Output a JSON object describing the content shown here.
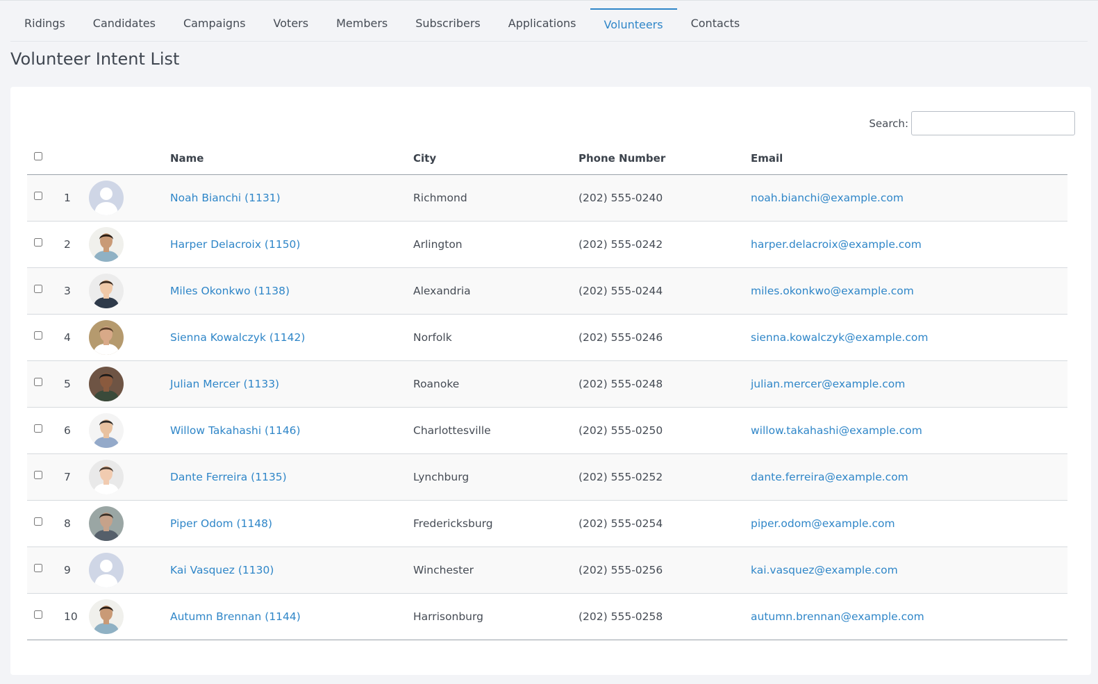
{
  "nav": {
    "tabs": [
      {
        "label": "Ridings"
      },
      {
        "label": "Candidates"
      },
      {
        "label": "Campaigns"
      },
      {
        "label": "Voters"
      },
      {
        "label": "Members"
      },
      {
        "label": "Subscribers"
      },
      {
        "label": "Applications"
      },
      {
        "label": "Volunteers"
      },
      {
        "label": "Contacts"
      }
    ],
    "active": "Volunteers"
  },
  "page": {
    "title": "Volunteer Intent List"
  },
  "search": {
    "label": "Search:",
    "value": "",
    "placeholder": ""
  },
  "table": {
    "headers": {
      "name": "Name",
      "city": "City",
      "phone": "Phone Number",
      "email": "Email"
    },
    "rows": [
      {
        "num": "1",
        "name": "Noah Bianchi (1131)",
        "city": "Richmond",
        "phone": "(202) 555-0240",
        "email": "noah.bianchi@example.com",
        "avatar": "placeholder"
      },
      {
        "num": "2",
        "name": "Harper Delacroix (1150)",
        "city": "Arlington",
        "phone": "(202) 555-0242",
        "email": "harper.delacroix@example.com",
        "avatar": "photo"
      },
      {
        "num": "3",
        "name": "Miles Okonkwo (1138)",
        "city": "Alexandria",
        "phone": "(202) 555-0244",
        "email": "miles.okonkwo@example.com",
        "avatar": "photo"
      },
      {
        "num": "4",
        "name": "Sienna Kowalczyk (1142)",
        "city": "Norfolk",
        "phone": "(202) 555-0246",
        "email": "sienna.kowalczyk@example.com",
        "avatar": "photo"
      },
      {
        "num": "5",
        "name": "Julian Mercer (1133)",
        "city": "Roanoke",
        "phone": "(202) 555-0248",
        "email": "julian.mercer@example.com",
        "avatar": "photo"
      },
      {
        "num": "6",
        "name": "Willow Takahashi (1146)",
        "city": "Charlottesville",
        "phone": "(202) 555-0250",
        "email": "willow.takahashi@example.com",
        "avatar": "photo"
      },
      {
        "num": "7",
        "name": "Dante Ferreira (1135)",
        "city": "Lynchburg",
        "phone": "(202) 555-0252",
        "email": "dante.ferreira@example.com",
        "avatar": "photo"
      },
      {
        "num": "8",
        "name": "Piper Odom (1148)",
        "city": "Fredericksburg",
        "phone": "(202) 555-0254",
        "email": "piper.odom@example.com",
        "avatar": "photo"
      },
      {
        "num": "9",
        "name": "Kai Vasquez (1130)",
        "city": "Winchester",
        "phone": "(202) 555-0256",
        "email": "kai.vasquez@example.com",
        "avatar": "placeholder"
      },
      {
        "num": "10",
        "name": "Autumn Brennan (1144)",
        "city": "Harrisonburg",
        "phone": "(202) 555-0258",
        "email": "autumn.brennan@example.com",
        "avatar": "photo"
      }
    ]
  },
  "colors": {
    "accent": "#2f86c8",
    "text": "#454b54",
    "placeholder_avatar_bg": "#cfd6e6",
    "placeholder_avatar_fg": "#ffffff"
  }
}
